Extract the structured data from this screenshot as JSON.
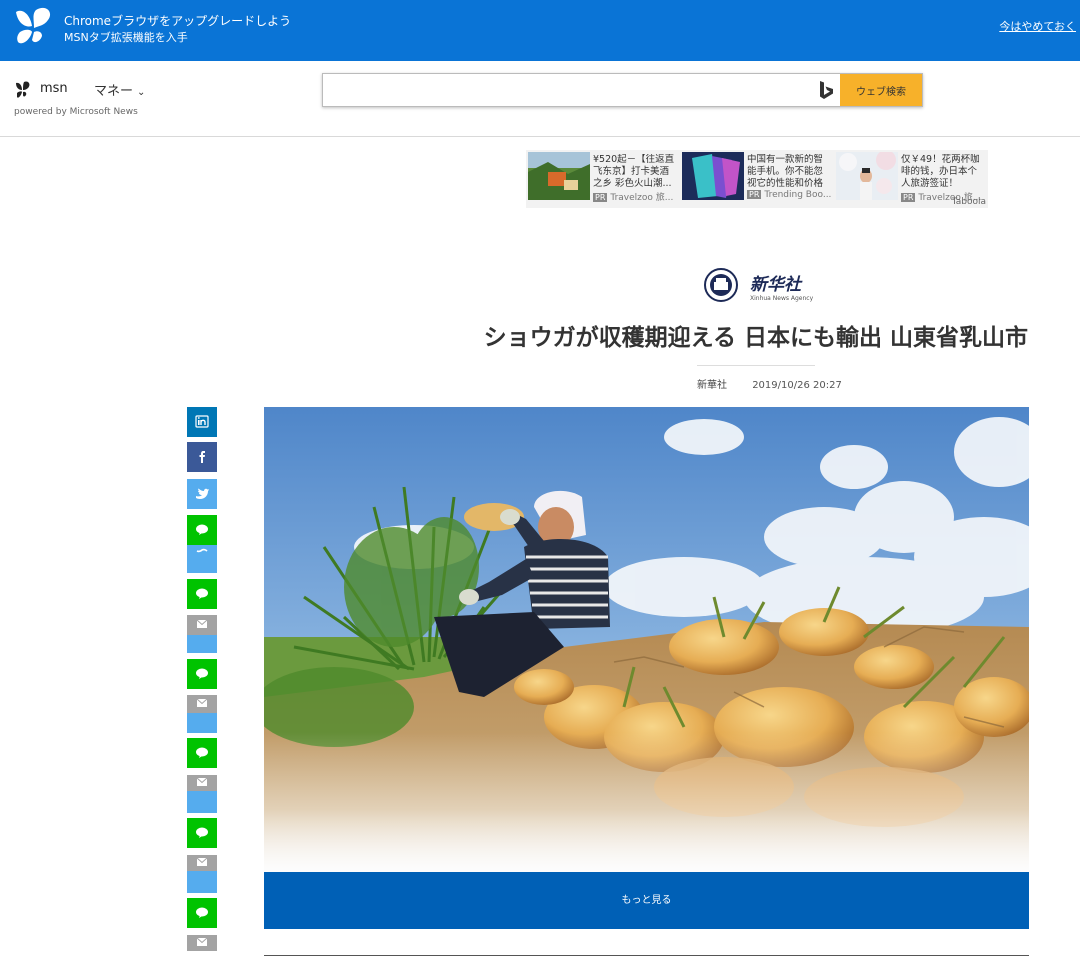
{
  "promo": {
    "line1": "Chromeブラウザをアップグレードしよう",
    "line2": "MSNタブ拡張機能を入手",
    "dismiss": "今はやめておく"
  },
  "header": {
    "brand": "msn",
    "section": "マネー",
    "powered_by": "powered by Microsoft News",
    "search_placeholder": "",
    "search_button": "ウェブ検索"
  },
  "ads": {
    "items": [
      {
        "text": "¥520起－【往返直飞东京】打卡美酒之乡 彩色火山潮...",
        "badge": "PR",
        "source": "Travelzoo 旅..."
      },
      {
        "text": "中国有一款新的智能手机。你不能忽视它的性能和价格",
        "badge": "PR",
        "source": "Trending Boo..."
      },
      {
        "text": "仅￥49！花两杯咖啡的钱，办日本个人旅游签证！",
        "badge": "PR",
        "source": "Travelzoo 旅..."
      }
    ],
    "provider": "Taboola"
  },
  "article": {
    "agency_cn": "新华社",
    "agency_en": "Xinhua News Agency",
    "title": "ショウガが収穫期迎える 日本にも輸出 山東省乳山市",
    "source": "新華社",
    "date": "2019/10/26 20:27",
    "more_button": "もっと見る"
  },
  "share_rail": [
    "linkedin",
    "facebook",
    "twitter",
    "line",
    "twitter",
    "line",
    "mail",
    "twitter",
    "line",
    "mail",
    "twitter",
    "line",
    "mail",
    "twitter",
    "line",
    "mail",
    "twitter",
    "line",
    "mail"
  ],
  "colors": {
    "promo_blue": "#0a74d6",
    "search_button": "#f7b12a",
    "more_button": "#0060b6",
    "linkedin": "#0077b5",
    "facebook": "#3b5998",
    "twitter": "#55acee",
    "line": "#00c300",
    "mail": "#a3a3a3"
  }
}
